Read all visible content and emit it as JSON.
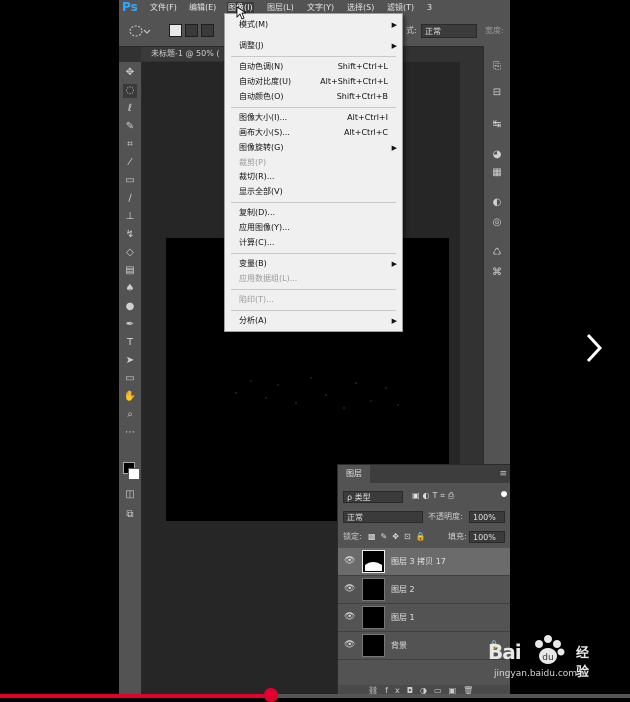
{
  "app": {
    "logo": "Ps",
    "menus": [
      "文件(F)",
      "编辑(E)",
      "图像(I)",
      "图层(L)",
      "文字(Y)",
      "选择(S)",
      "滤镜(T)",
      "3"
    ],
    "active_menu_index": 2
  },
  "options_bar": {
    "mode_label": "式:",
    "mode_value": "正常",
    "extra_label": "宽度:"
  },
  "document": {
    "tab_title": "未标题-1 @ 50% ("
  },
  "image_menu": {
    "items": [
      {
        "label": "模式(M)",
        "shortcut": "",
        "submenu": true,
        "disabled": false
      },
      {
        "label": "调整(J)",
        "shortcut": "",
        "submenu": true,
        "disabled": false
      },
      {
        "label": "自动色调(N)",
        "shortcut": "Shift+Ctrl+L",
        "submenu": false,
        "disabled": false
      },
      {
        "label": "自动对比度(U)",
        "shortcut": "Alt+Shift+Ctrl+L",
        "submenu": false,
        "disabled": false
      },
      {
        "label": "自动颜色(O)",
        "shortcut": "Shift+Ctrl+B",
        "submenu": false,
        "disabled": false
      },
      {
        "label": "图像大小(I)...",
        "shortcut": "Alt+Ctrl+I",
        "submenu": false,
        "disabled": false
      },
      {
        "label": "画布大小(S)...",
        "shortcut": "Alt+Ctrl+C",
        "submenu": false,
        "disabled": false
      },
      {
        "label": "图像旋转(G)",
        "shortcut": "",
        "submenu": true,
        "disabled": false
      },
      {
        "label": "裁剪(P)",
        "shortcut": "",
        "submenu": false,
        "disabled": true
      },
      {
        "label": "裁切(R)...",
        "shortcut": "",
        "submenu": false,
        "disabled": false
      },
      {
        "label": "显示全部(V)",
        "shortcut": "",
        "submenu": false,
        "disabled": false
      },
      {
        "label": "复制(D)...",
        "shortcut": "",
        "submenu": false,
        "disabled": false
      },
      {
        "label": "应用图像(Y)...",
        "shortcut": "",
        "submenu": false,
        "disabled": false
      },
      {
        "label": "计算(C)...",
        "shortcut": "",
        "submenu": false,
        "disabled": false
      },
      {
        "label": "变量(B)",
        "shortcut": "",
        "submenu": true,
        "disabled": false
      },
      {
        "label": "应用数据组(L)...",
        "shortcut": "",
        "submenu": false,
        "disabled": true
      },
      {
        "label": "陷印(T)...",
        "shortcut": "",
        "submenu": false,
        "disabled": true
      },
      {
        "label": "分析(A)",
        "shortcut": "",
        "submenu": true,
        "disabled": false
      }
    ]
  },
  "layers_panel": {
    "tab_label": "图层",
    "filter_label": "ρ 类型",
    "blend_mode": "正常",
    "opacity_label": "不透明度:",
    "opacity_value": "100%",
    "lock_label": "锁定:",
    "fill_label": "填充:",
    "fill_value": "100%",
    "layers": [
      {
        "name": "图层 3 拷贝 17",
        "selected": true
      },
      {
        "name": "图层 2",
        "selected": false
      },
      {
        "name": "图层 1",
        "selected": false
      },
      {
        "name": "背景",
        "selected": false
      }
    ]
  },
  "watermark": {
    "brand": "Bai",
    "brand2": "经验",
    "url": "jingyan.baidu.com"
  },
  "video": {
    "progress": 0.43
  },
  "colors": {
    "accent": "#31a8ff",
    "progress": "#e1002d"
  }
}
